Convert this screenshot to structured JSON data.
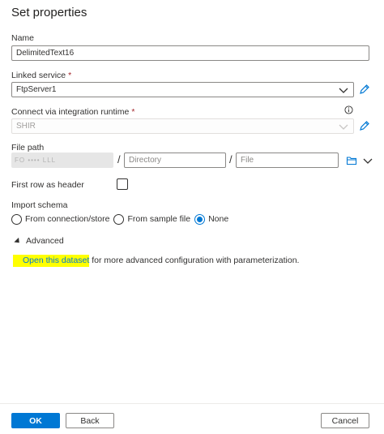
{
  "panel": {
    "title": "Set properties"
  },
  "name": {
    "label": "Name",
    "value": "DelimitedText16"
  },
  "linked_service": {
    "label": "Linked service",
    "required": "*",
    "value": "FtpServer1"
  },
  "integration_runtime": {
    "label": "Connect via integration runtime",
    "required": "*",
    "value": "SHIR"
  },
  "file_path": {
    "label": "File path",
    "container_masked_text": "FO ••••  LLL",
    "separator": "/",
    "directory_placeholder": "Directory",
    "file_placeholder": "File"
  },
  "first_row_header": {
    "label": "First row as header",
    "checked": false
  },
  "import_schema": {
    "label": "Import schema",
    "options": [
      {
        "label": "From connection/store",
        "checked": false
      },
      {
        "label": "From sample file",
        "checked": false
      },
      {
        "label": "None",
        "checked": true
      }
    ]
  },
  "advanced": {
    "label": "Advanced",
    "link_text": "Open this dataset",
    "rest_text": " for more advanced configuration with parameterization."
  },
  "footer": {
    "ok_label": "OK",
    "back_label": "Back",
    "cancel_label": "Cancel"
  },
  "colors": {
    "accent": "#0078d4",
    "highlight": "#ffff00",
    "required": "#a4262c"
  },
  "icons": [
    "pencil-icon",
    "chevron-down-icon",
    "info-icon",
    "folder-icon"
  ]
}
